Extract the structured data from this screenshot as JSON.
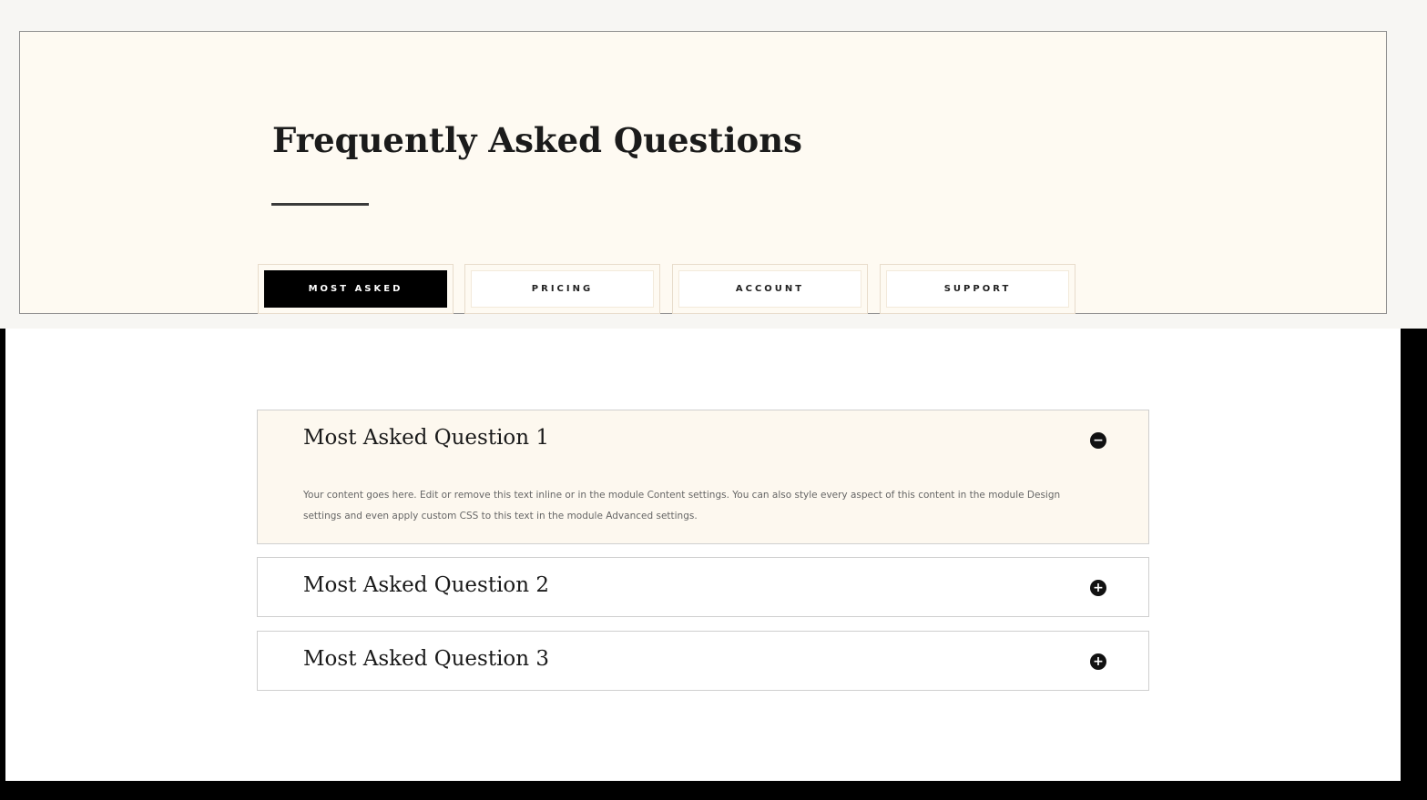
{
  "page": {
    "title": "Frequently Asked Questions"
  },
  "tabs": [
    {
      "label": "MOST ASKED",
      "active": true
    },
    {
      "label": "PRICING",
      "active": false
    },
    {
      "label": "ACCOUNT",
      "active": false
    },
    {
      "label": "SUPPORT",
      "active": false
    }
  ],
  "accordion": [
    {
      "title": "Most Asked Question 1",
      "open": true,
      "icon": "minus-circle-icon",
      "toggle_glyph": "−",
      "body": "Your content goes here. Edit or remove this text inline or in the module Content settings. You can also style every aspect of this content in the module Design settings and even apply custom CSS to this text in the module Advanced settings."
    },
    {
      "title": "Most Asked Question 2",
      "open": false,
      "icon": "plus-circle-icon",
      "toggle_glyph": "+"
    },
    {
      "title": "Most Asked Question 3",
      "open": false,
      "icon": "plus-circle-icon",
      "toggle_glyph": "+"
    }
  ],
  "colors": {
    "hero_background": "#fefaf2",
    "active_tab": "#000000",
    "open_item_background": "#fdf8ef"
  }
}
